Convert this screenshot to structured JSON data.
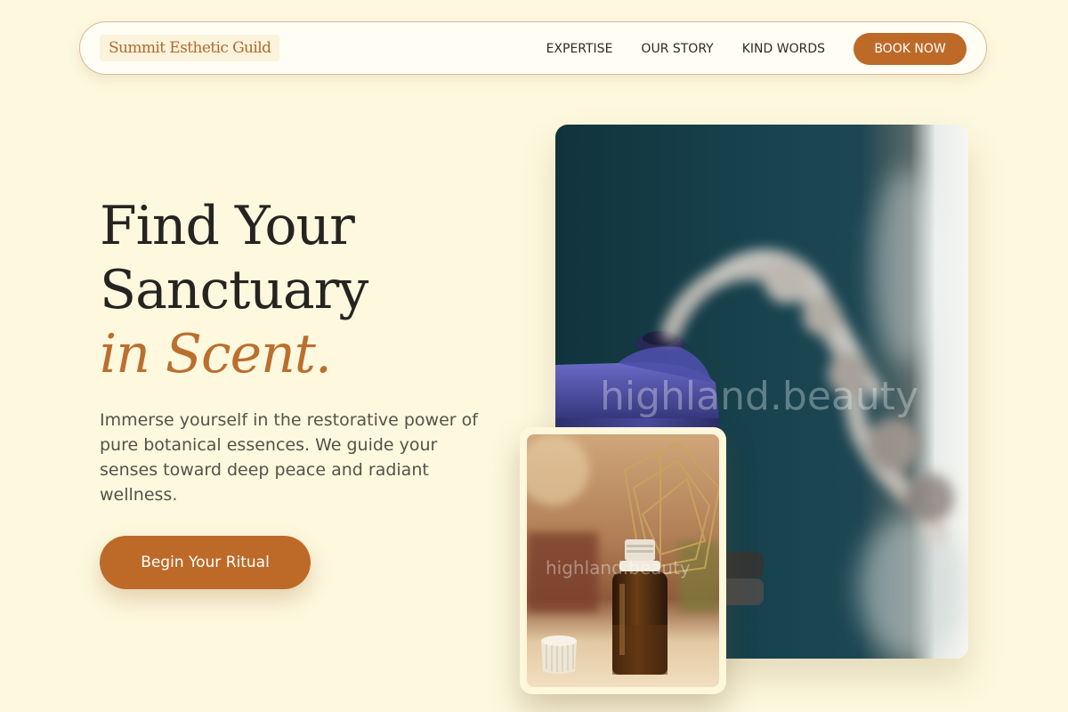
{
  "nav": {
    "brand": "Summit Esthetic Guild",
    "links": [
      {
        "label": "EXPERTISE"
      },
      {
        "label": "OUR STORY"
      },
      {
        "label": "KIND WORDS"
      }
    ],
    "cta_label": "BOOK NOW"
  },
  "hero": {
    "headline_line1": "Find Your",
    "headline_line2": "Sanctuary",
    "headline_accent": "in Scent.",
    "description": "Immerse yourself in the restorative power of pure botanical essences. We guide your senses toward deep peace and radiant wellness.",
    "cta_label": "Begin Your Ritual"
  },
  "images": {
    "main": {
      "subject": "aroma diffuser releasing mist",
      "watermark": "highland.beauty"
    },
    "inset": {
      "subject": "amber essential oil bottle with cap",
      "watermark": "highland.beauty"
    }
  },
  "colors": {
    "background": "#fdf8de",
    "accent": "#bd6a29",
    "heading": "#262320",
    "body_text": "#57514a"
  }
}
